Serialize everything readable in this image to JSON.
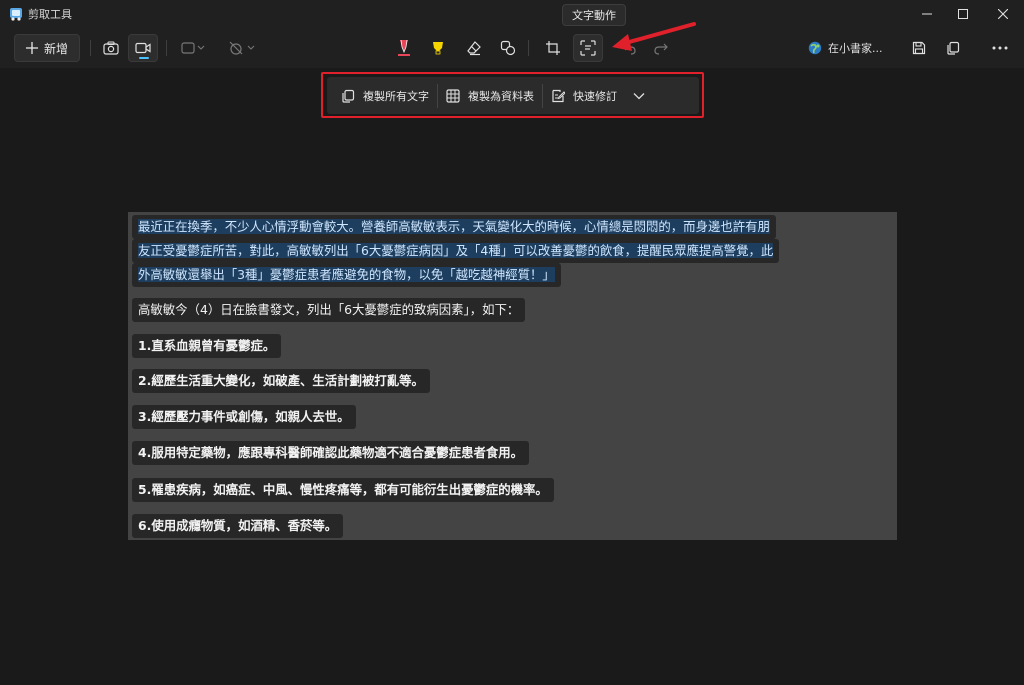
{
  "window": {
    "title": "剪取工具"
  },
  "toolbar": {
    "new_label": "新增",
    "user_name": "在小書家..."
  },
  "tooltip": {
    "text": "文字動作"
  },
  "text_actions": {
    "copy_all": "複製所有文字",
    "copy_table": "複製為資料表",
    "quick_redact": "快速修訂"
  },
  "content": {
    "p1_l1": "最近正在換季，不少人心情浮動會較大。營養師高敏敏表示，天氣變化大的時候，心情總是悶悶的，而身邊也許有朋",
    "p1_l2": "友正受憂鬱症所苦，對此，高敏敏列出「6大憂鬱症病因」及「4種」可以改善憂鬱的飲食，提醒民眾應提高警覺，此",
    "p1_l3": "外高敏敏還舉出「3種」憂鬱症患者應避免的食物，以免「越吃越神經質！」",
    "p2": "高敏敏今（4）日在臉書發文，列出「6大憂鬱症的致病因素」，如下：",
    "items": [
      "1.直系血親曾有憂鬱症。",
      "2.經歷生活重大變化，如破產、生活計劃被打亂等。",
      "3.經歷壓力事件或創傷，如親人去世。",
      "4.服用特定藥物，應跟專科醫師確認此藥物適不適合憂鬱症患者食用。",
      "5.罹患疾病，如癌症、中風、慢性疼痛等，都有可能衍生出憂鬱症的機率。",
      "6.使用成癮物質，如酒精、香菸等。"
    ]
  },
  "colors": {
    "accent": "#4cc2ff",
    "highlight_red": "#e0202a",
    "pen_red": "#e8455a",
    "highlighter_yellow": "#f5d400"
  }
}
